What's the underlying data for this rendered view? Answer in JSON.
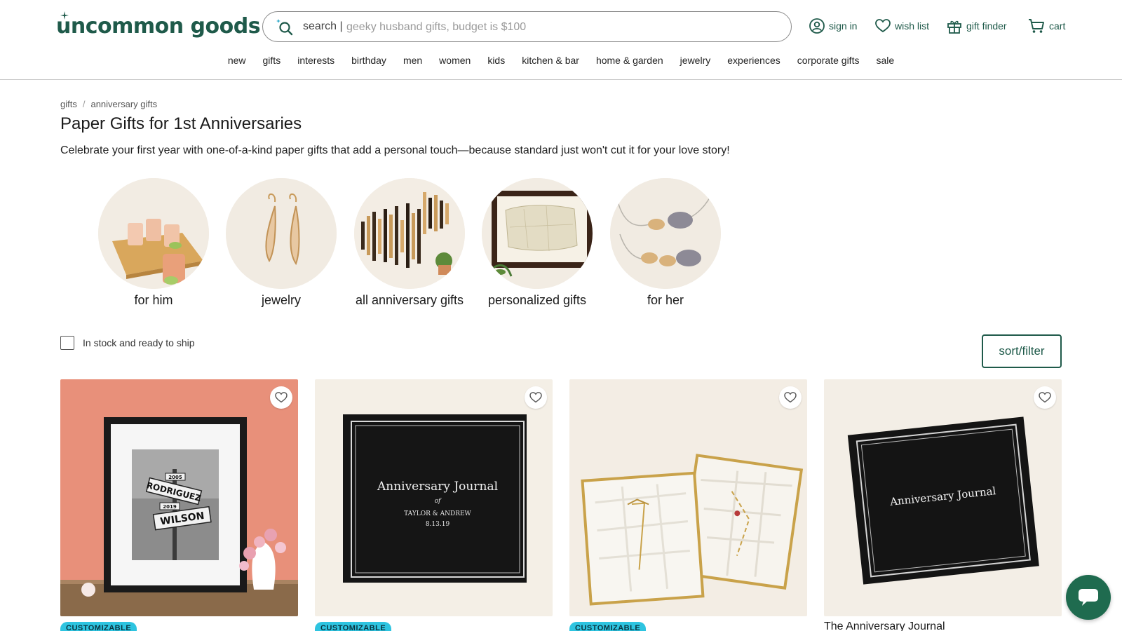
{
  "brand": {
    "logo_text": "uncommon goods",
    "accent": "#1f5a4a",
    "badge_color": "#2ec4e0"
  },
  "search": {
    "label": "search |",
    "placeholder": "geeky husband gifts, budget is $100"
  },
  "utility": {
    "sign_in": "sign in",
    "wish_list": "wish list",
    "gift_finder": "gift finder",
    "cart": "cart"
  },
  "nav": [
    "new",
    "gifts",
    "interests",
    "birthday",
    "men",
    "women",
    "kids",
    "kitchen & bar",
    "home & garden",
    "jewelry",
    "experiences",
    "corporate gifts",
    "sale"
  ],
  "breadcrumb": [
    "gifts",
    "anniversary gifts"
  ],
  "page": {
    "title": "Paper Gifts for 1st Anniversaries",
    "description": "Celebrate your first year with one-of-a-kind paper gifts that add a personal touch—because standard just won't cut it for your love story!"
  },
  "categories": [
    {
      "label": "for him",
      "icon": "shot-glasses-image"
    },
    {
      "label": "jewelry",
      "icon": "earrings-image"
    },
    {
      "label": "all anniversary gifts",
      "icon": "soundwave-art-image"
    },
    {
      "label": "personalized gifts",
      "icon": "framed-map-image"
    },
    {
      "label": "for her",
      "icon": "bear-necklace-image"
    }
  ],
  "filters": {
    "in_stock_label": "In stock and ready to ship",
    "sort_filter_label": "sort/filter"
  },
  "products": [
    {
      "badge": "CUSTOMIZABLE",
      "image": "street-sign-print",
      "sign_top": "2005",
      "sign_1": "RODRIGUEZ",
      "sign_mid": "2019",
      "sign_2": "WILSON"
    },
    {
      "badge": "CUSTOMIZABLE",
      "image": "anniversary-journal-black",
      "journal_title": "Anniversary Journal",
      "journal_of": "of",
      "journal_names": "TAYLOR & ANDREW",
      "journal_date": "8.13.19"
    },
    {
      "badge": "CUSTOMIZABLE",
      "image": "framed-paper-maps"
    },
    {
      "title": "The Anniversary Journal",
      "image": "anniversary-journal-angled",
      "journal_title": "Anniversary Journal"
    }
  ]
}
